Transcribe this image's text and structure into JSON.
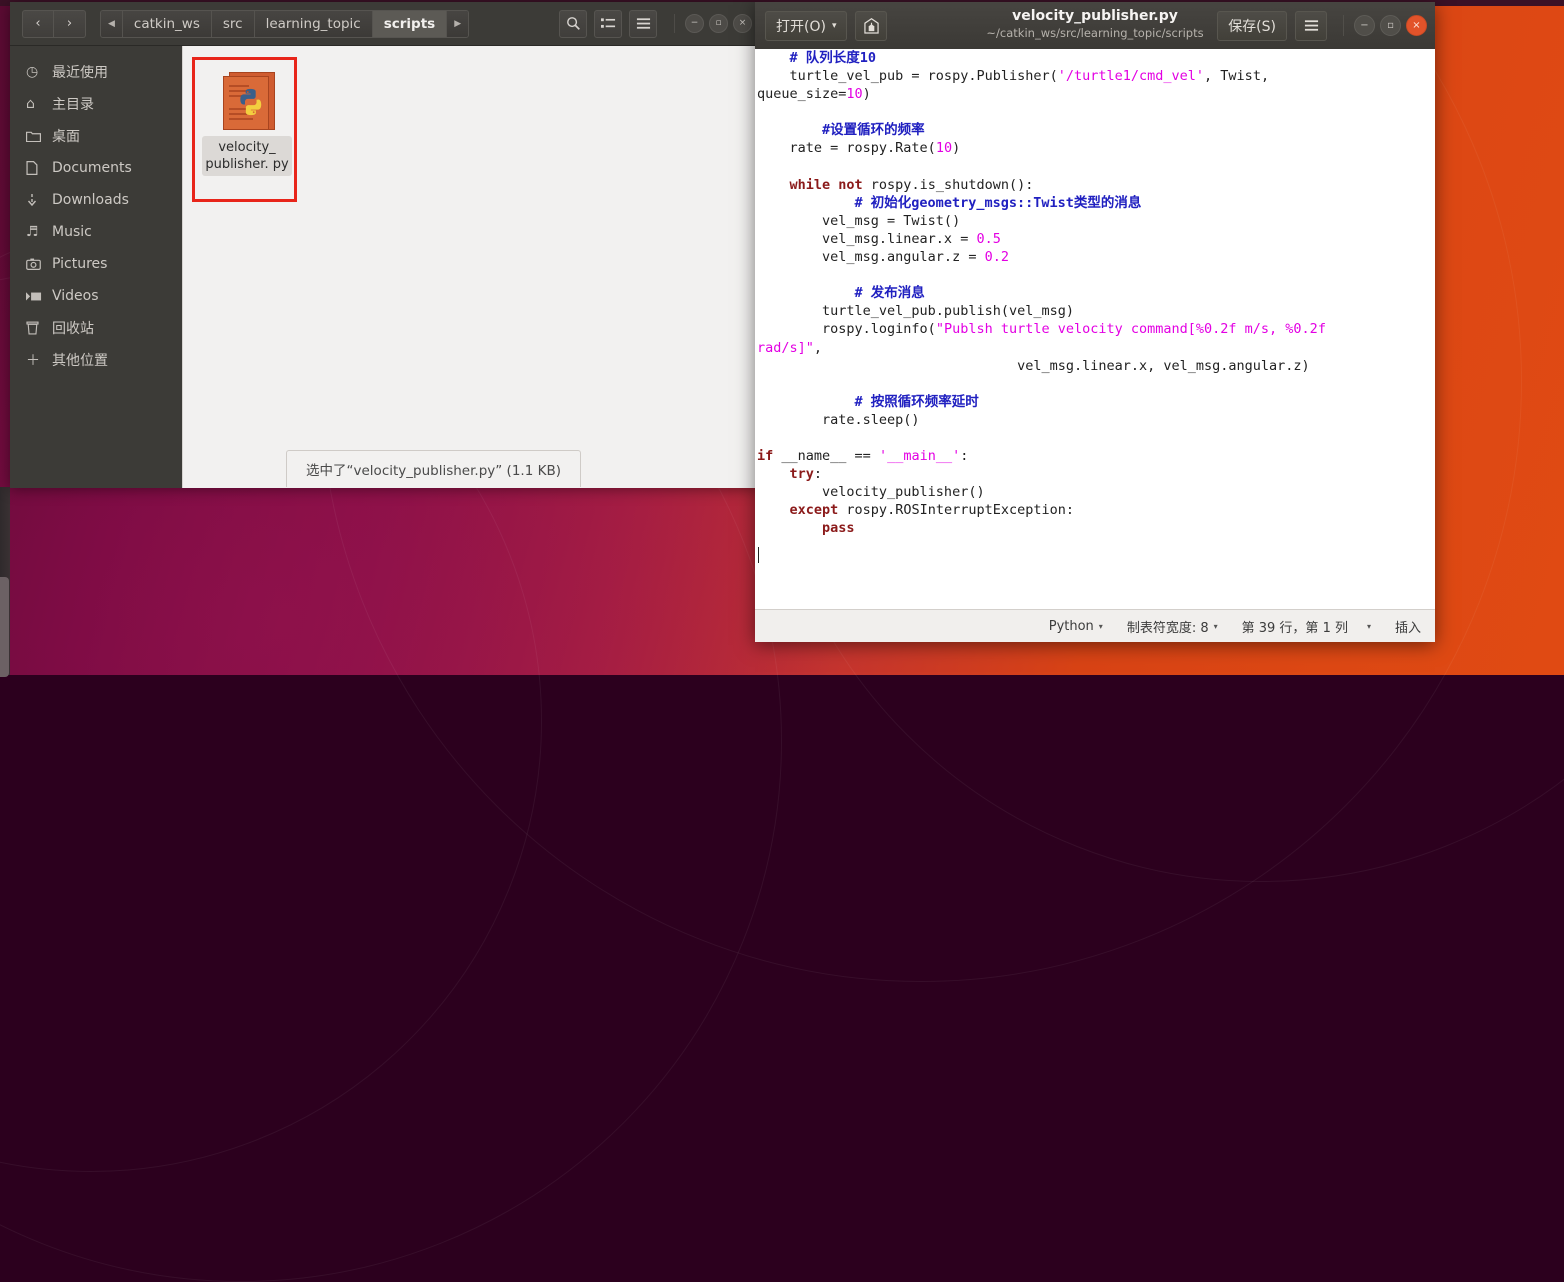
{
  "file_manager": {
    "nav": {
      "back": "‹",
      "forward": "›"
    },
    "breadcrumb_prev": "◀",
    "breadcrumb_next": "▶",
    "breadcrumbs": [
      {
        "label": "catkin_ws",
        "current": false
      },
      {
        "label": "src",
        "current": false
      },
      {
        "label": "learning_topic",
        "current": false
      },
      {
        "label": "scripts",
        "current": true
      }
    ],
    "toolbar": {
      "search_icon": "search-icon",
      "view_icon": "list-view-icon",
      "menu_icon": "hamburger-menu-icon"
    },
    "window_buttons": {
      "minimize": "−",
      "maximize": "▫",
      "close": "×"
    },
    "sidebar": {
      "items": [
        {
          "icon": "clock-icon",
          "glyph": "◷",
          "label": "最近使用"
        },
        {
          "icon": "home-icon",
          "glyph": "⌂",
          "label": "主目录"
        },
        {
          "icon": "folder-icon",
          "glyph": "▰",
          "label": "桌面"
        },
        {
          "icon": "document-icon",
          "glyph": "🗋",
          "label": "Documents"
        },
        {
          "icon": "download-icon",
          "glyph": "⤓",
          "label": "Downloads"
        },
        {
          "icon": "music-icon",
          "glyph": "♫",
          "label": "Music"
        },
        {
          "icon": "camera-icon",
          "glyph": "▣",
          "label": "Pictures"
        },
        {
          "icon": "video-icon",
          "glyph": "▶",
          "label": "Videos"
        },
        {
          "icon": "trash-icon",
          "glyph": "🗑",
          "label": "回收站"
        },
        {
          "icon": "plus-icon",
          "glyph": "+",
          "label": "其他位置"
        }
      ]
    },
    "file": {
      "icon": "python-file-icon",
      "name": "velocity_\npublisher.\npy"
    },
    "status": "选中了“velocity_publisher.py” (1.1 KB)"
  },
  "editor": {
    "open_button": "打开(O)",
    "open_caret": "▾",
    "save_as_icon": "save-as-icon",
    "title": "velocity_publisher.py",
    "subtitle": "~/catkin_ws/src/learning_topic/scripts",
    "save_button": "保存(S)",
    "menu_icon": "hamburger-menu-icon",
    "window_buttons": {
      "minimize": "−",
      "maximize": "▫",
      "close": "×"
    },
    "code_lines": [
      [
        {
          "t": "    ",
          "c": ""
        },
        {
          "t": "# 队列长度10",
          "c": "cm"
        }
      ],
      [
        {
          "t": "    turtle_vel_pub = rospy.Publisher(",
          "c": ""
        },
        {
          "t": "'/turtle1/cmd_vel'",
          "c": "st"
        },
        {
          "t": ", Twist,",
          "c": ""
        }
      ],
      [
        {
          "t": "queue_size=",
          "c": ""
        },
        {
          "t": "10",
          "c": "nu"
        },
        {
          "t": ")",
          "c": ""
        }
      ],
      [
        {
          "t": "",
          "c": ""
        }
      ],
      [
        {
          "t": "        ",
          "c": ""
        },
        {
          "t": "#设置循环的频率",
          "c": "cm"
        }
      ],
      [
        {
          "t": "    rate = rospy.Rate(",
          "c": ""
        },
        {
          "t": "10",
          "c": "nu"
        },
        {
          "t": ")",
          "c": ""
        }
      ],
      [
        {
          "t": "",
          "c": ""
        }
      ],
      [
        {
          "t": "    ",
          "c": ""
        },
        {
          "t": "while not",
          "c": "kw"
        },
        {
          "t": " rospy.is_shutdown():",
          "c": ""
        }
      ],
      [
        {
          "t": "            ",
          "c": ""
        },
        {
          "t": "# 初始化geometry_msgs::Twist类型的消息",
          "c": "cm"
        }
      ],
      [
        {
          "t": "        vel_msg = Twist()",
          "c": ""
        }
      ],
      [
        {
          "t": "        vel_msg.linear.x = ",
          "c": ""
        },
        {
          "t": "0.5",
          "c": "nu"
        }
      ],
      [
        {
          "t": "        vel_msg.angular.z = ",
          "c": ""
        },
        {
          "t": "0.2",
          "c": "nu"
        }
      ],
      [
        {
          "t": "",
          "c": ""
        }
      ],
      [
        {
          "t": "            ",
          "c": ""
        },
        {
          "t": "# 发布消息",
          "c": "cm"
        }
      ],
      [
        {
          "t": "        turtle_vel_pub.publish(vel_msg)",
          "c": ""
        }
      ],
      [
        {
          "t": "        rospy.loginfo(",
          "c": ""
        },
        {
          "t": "\"Publsh turtle velocity command[%0.2f m/s, %0.2f",
          "c": "st"
        }
      ],
      [
        {
          "t": "rad/s]\"",
          "c": "st"
        },
        {
          "t": ",",
          "c": ""
        }
      ],
      [
        {
          "t": "                                vel_msg.linear.x, vel_msg.angular.z)",
          "c": ""
        }
      ],
      [
        {
          "t": "",
          "c": ""
        }
      ],
      [
        {
          "t": "            ",
          "c": ""
        },
        {
          "t": "# 按照循环频率延时",
          "c": "cm"
        }
      ],
      [
        {
          "t": "        rate.sleep()",
          "c": ""
        }
      ],
      [
        {
          "t": "",
          "c": ""
        }
      ],
      [
        {
          "t": "if",
          "c": "kw"
        },
        {
          "t": " __name__ == ",
          "c": ""
        },
        {
          "t": "'__main__'",
          "c": "st"
        },
        {
          "t": ":",
          "c": ""
        }
      ],
      [
        {
          "t": "    ",
          "c": ""
        },
        {
          "t": "try",
          "c": "kw"
        },
        {
          "t": ":",
          "c": ""
        }
      ],
      [
        {
          "t": "        velocity_publisher()",
          "c": ""
        }
      ],
      [
        {
          "t": "    ",
          "c": ""
        },
        {
          "t": "except",
          "c": "kw"
        },
        {
          "t": " rospy.ROSInterruptException:",
          "c": ""
        }
      ],
      [
        {
          "t": "        ",
          "c": ""
        },
        {
          "t": "pass",
          "c": "kw"
        }
      ]
    ],
    "status_bar": {
      "language": "Python",
      "tab_width": "制表符宽度: 8",
      "position": "第 39 行，第 1 列",
      "insert_mode": "插入",
      "caret": "▾"
    }
  },
  "colors": {
    "accent_orange": "#dd4814",
    "selection_red": "#e8251a",
    "header_dark": "#3c3b37",
    "comment_blue": "#2020c0",
    "keyword_red": "#8b1a1a",
    "string_magenta": "#e300e3"
  }
}
